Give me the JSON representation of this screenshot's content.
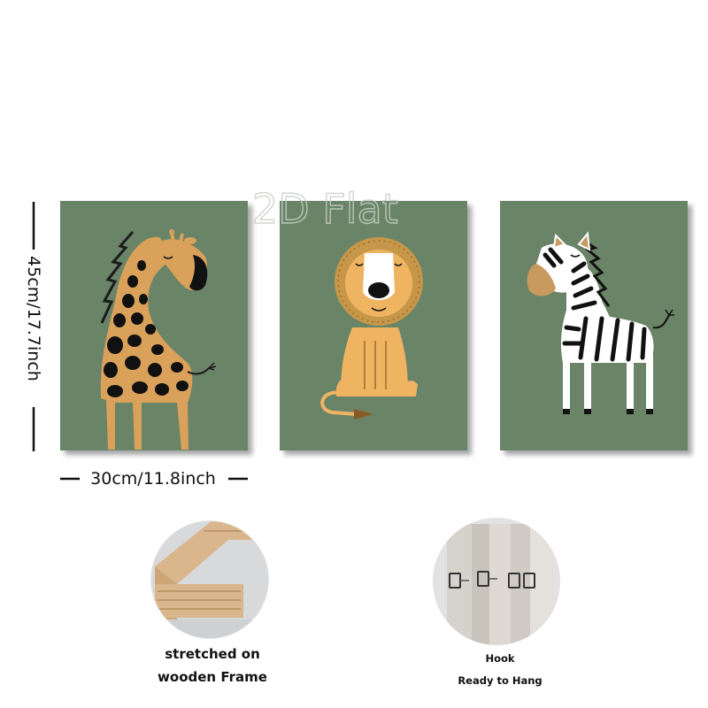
{
  "watermark": "2D Flat",
  "dimensions": {
    "height_label": "45cm/17.7inch",
    "width_label": "30cm/11.8inch"
  },
  "panels": [
    {
      "animal": "giraffe"
    },
    {
      "animal": "lion"
    },
    {
      "animal": "zebra"
    }
  ],
  "features": [
    {
      "lines": [
        "stretched on",
        "wooden Frame"
      ],
      "icon": "wooden-frame-photo"
    },
    {
      "lines": [
        "Hook",
        "Ready to Hang"
      ],
      "icon": "hook-photo"
    }
  ],
  "colors": {
    "panel_bg": "#6a8467",
    "giraffe": "#d9a15a",
    "lion": "#efb462",
    "lion_mane": "#c79749",
    "zebra_nose": "#c89a60"
  }
}
